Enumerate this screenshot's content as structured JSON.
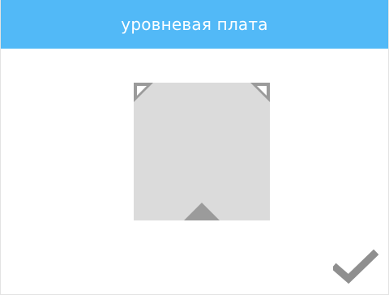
{
  "header": {
    "title": "уровневая плата",
    "background_color": "#52b9f7",
    "text_color": "#ffffff"
  },
  "plate": {
    "background_color": "#dbdbdb",
    "marker_color": "#9b9b9b",
    "markers": [
      "front-left-corner-marker",
      "front-right-corner-marker",
      "rear-center-marker"
    ]
  },
  "actions": {
    "confirm_icon": "checkmark-icon",
    "confirm_color": "#8f8f8f"
  }
}
